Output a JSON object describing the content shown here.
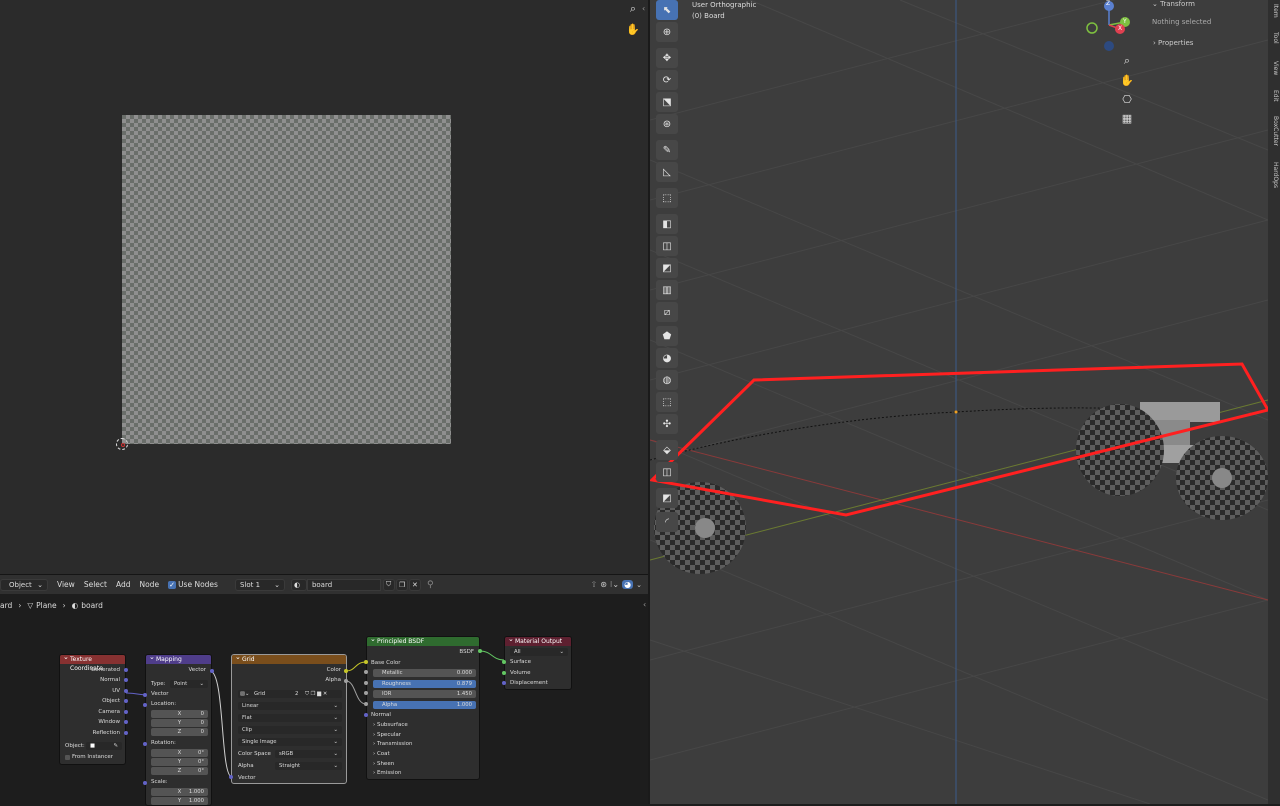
{
  "node_editor": {
    "header": {
      "mode": "Object",
      "menu_view": "View",
      "menu_select": "Select",
      "menu_add": "Add",
      "menu_node": "Node",
      "use_nodes": "Use Nodes",
      "slot": "Slot 1",
      "material": "board"
    },
    "breadcrumb": {
      "first": "ard",
      "second": "Plane",
      "third": "board"
    },
    "nodes": {
      "texcoord": {
        "title": "Texture Coordinate",
        "outputs": [
          "Generated",
          "Normal",
          "UV",
          "Object",
          "Camera",
          "Window",
          "Reflection"
        ],
        "object_label": "Object:",
        "from_instancer": "From Instancer"
      },
      "mapping": {
        "title": "Mapping",
        "out": "Vector",
        "type_label": "Type:",
        "type_value": "Point",
        "vector": "Vector",
        "location": "Location:",
        "loc": [
          {
            "axis": "X",
            "val": "0"
          },
          {
            "axis": "Y",
            "val": "0"
          },
          {
            "axis": "Z",
            "val": "0"
          }
        ],
        "rotation": "Rotation:",
        "rot": [
          {
            "axis": "X",
            "val": "0°"
          },
          {
            "axis": "Y",
            "val": "0°"
          },
          {
            "axis": "Z",
            "val": "0°"
          }
        ],
        "scale": "Scale:",
        "scl": [
          {
            "axis": "X",
            "val": "1.000"
          },
          {
            "axis": "Y",
            "val": "1.000"
          }
        ]
      },
      "grid": {
        "title": "Grid",
        "out_color": "Color",
        "out_alpha": "Alpha",
        "image_name": "Grid",
        "users": "2",
        "interpolation": "Linear",
        "projection": "Flat",
        "extension": "Clip",
        "source": "Single Image",
        "colorspace_label": "Color Space",
        "colorspace": "sRGB",
        "alpha_label": "Alpha",
        "alpha": "Straight",
        "in_vector": "Vector"
      },
      "bsdf": {
        "title": "Principled BSDF",
        "out": "BSDF",
        "base_color": "Base Color",
        "metallic": {
          "label": "Metallic",
          "val": "0.000"
        },
        "roughness": {
          "label": "Roughness",
          "val": "0.879"
        },
        "ior": {
          "label": "IOR",
          "val": "1.450"
        },
        "alpha": {
          "label": "Alpha",
          "val": "1.000"
        },
        "normal": "Normal",
        "panels": [
          "Subsurface",
          "Specular",
          "Transmission",
          "Coat",
          "Sheen",
          "Emission"
        ]
      },
      "output": {
        "title": "Material Output",
        "target": "All",
        "surface": "Surface",
        "volume": "Volume",
        "displacement": "Displacement"
      }
    }
  },
  "viewport": {
    "view_name": "User Orthographic",
    "object_name": "(0) Board",
    "panel_transform": "Transform",
    "panel_nothing": "Nothing selected",
    "panel_properties": "Properties",
    "tabs": [
      "Item",
      "Tool",
      "View",
      "Edit",
      "BoxCutter",
      "HardOps"
    ],
    "gizmo": {
      "z": "Z",
      "y": "Y",
      "x": "X"
    }
  },
  "colors": {
    "selection": "#ff2020",
    "active_tool": "#4772b3",
    "socket_yellow": "#c7c729",
    "socket_purple": "#6363c7",
    "socket_gray": "#a1a1a1",
    "socket_green": "#63c763"
  }
}
